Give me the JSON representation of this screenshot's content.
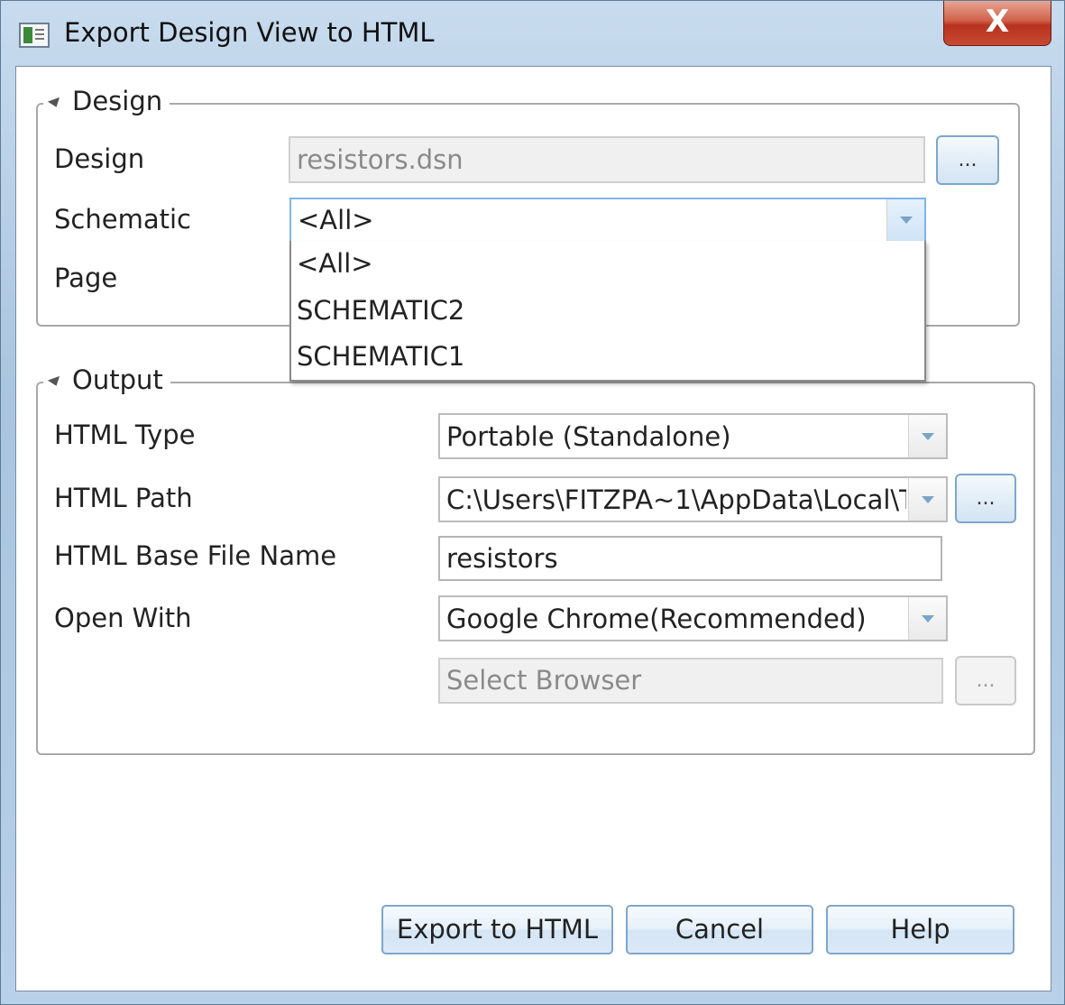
{
  "window": {
    "title": "Export Design View to HTML",
    "close_label": "X"
  },
  "design_group": {
    "legend": "Design",
    "design_label": "Design",
    "design_value": "resistors.dsn",
    "browse_label": "...",
    "schematic_label": "Schematic",
    "schematic_value": "<All>",
    "page_label": "Page",
    "schematic_options": [
      "<All>",
      "SCHEMATIC2",
      "SCHEMATIC1"
    ]
  },
  "output_group": {
    "legend": "Output",
    "html_type_label": "HTML Type",
    "html_type_value": "Portable (Standalone)",
    "html_path_label": "HTML Path",
    "html_path_value": "C:\\Users\\FITZPA~1\\AppData\\Local\\T",
    "path_browse_label": "...",
    "base_name_label": "HTML Base File Name",
    "base_name_value": "resistors",
    "open_with_label": "Open With",
    "open_with_value": "Google Chrome(Recommended)",
    "browser_placeholder": "Select Browser",
    "browser_browse_label": "..."
  },
  "buttons": {
    "export": "Export to HTML",
    "cancel": "Cancel",
    "help": "Help"
  },
  "icons": [
    "app-icon",
    "close-icon",
    "collapse-arrow-icon",
    "dropdown-arrow-icon"
  ]
}
